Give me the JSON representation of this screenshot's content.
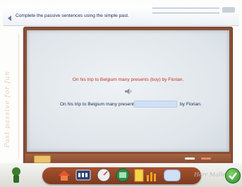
{
  "instruction": {
    "text": "Complete the passive sentences using the simple past."
  },
  "margin": {
    "handwriting": "Past passive for fun"
  },
  "exercise": {
    "prompt": "On his trip to Belgium many presents (buy) by Florian.",
    "sentence_start": "On his trip to Belgium many presents",
    "answer_value": "",
    "sentence_end": "by Florian."
  },
  "toolbar": {
    "signature": "Herr Maller",
    "tools": [
      "home-icon",
      "scoreboard-icon",
      "gauge-icon",
      "vocabulary-icon",
      "notebook-icon",
      "statistics-icon",
      "help-icon"
    ],
    "check_icon": "checkmark-icon"
  },
  "colors": {
    "prompt": "#c4321f",
    "text": "#1a2c54",
    "board_frame": "#8a4f36",
    "input": "#cfe0f5"
  }
}
